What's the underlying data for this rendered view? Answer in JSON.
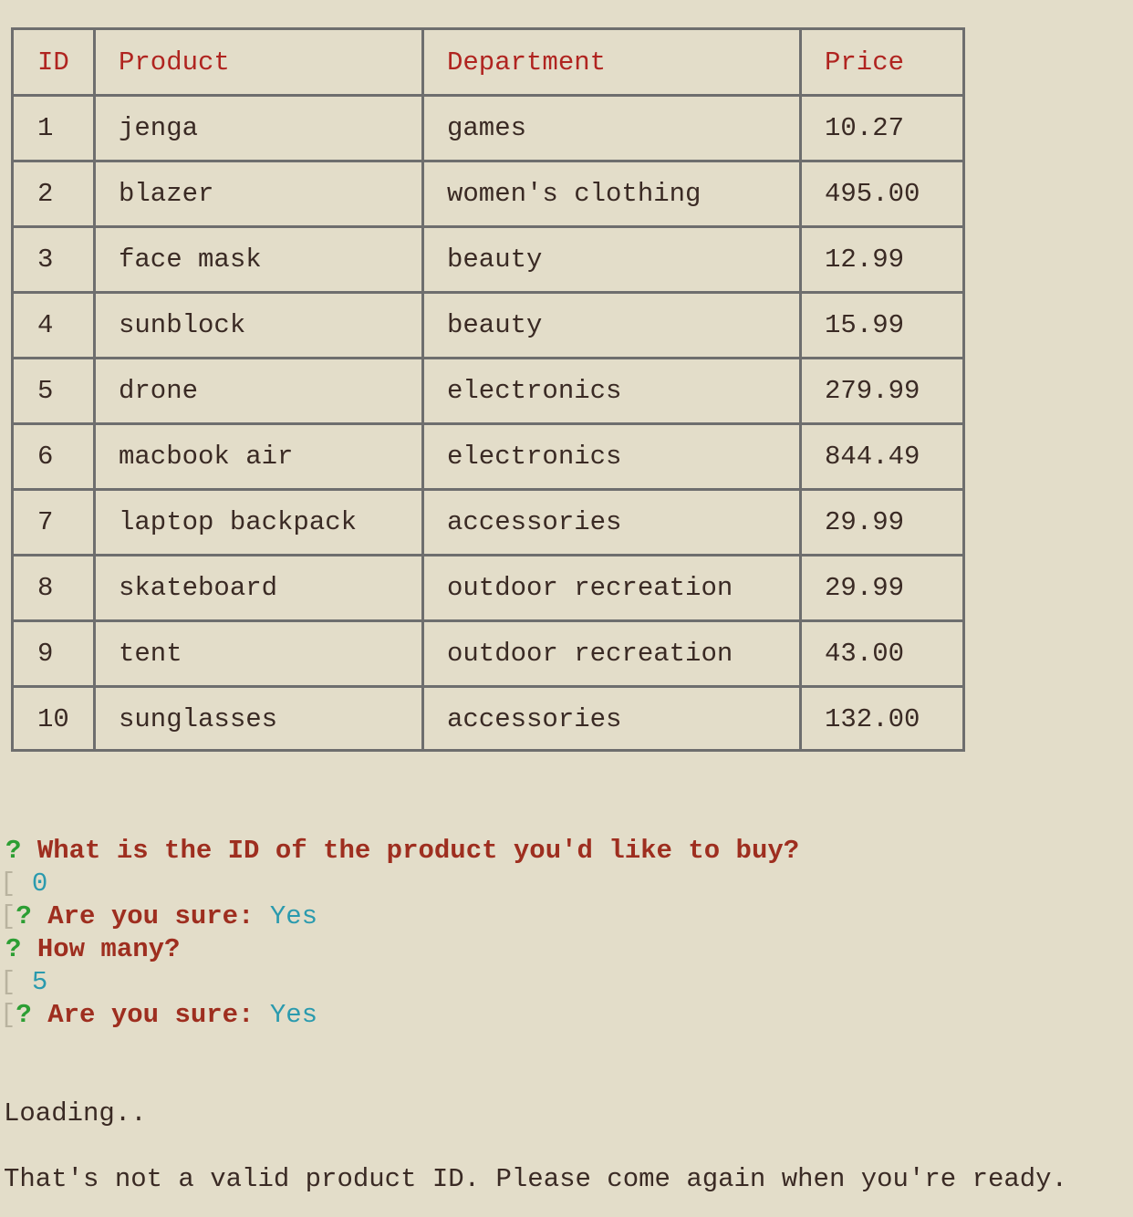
{
  "table": {
    "headers": {
      "id": "ID",
      "product": "Product",
      "department": "Department",
      "price": "Price"
    },
    "rows": [
      {
        "id": "1",
        "product": "jenga",
        "department": "games",
        "price": "10.27"
      },
      {
        "id": "2",
        "product": "blazer",
        "department": "women's clothing",
        "price": "495.00"
      },
      {
        "id": "3",
        "product": "face mask",
        "department": "beauty",
        "price": "12.99"
      },
      {
        "id": "4",
        "product": "sunblock",
        "department": "beauty",
        "price": "15.99"
      },
      {
        "id": "5",
        "product": "drone",
        "department": "electronics",
        "price": "279.99"
      },
      {
        "id": "6",
        "product": "macbook air",
        "department": "electronics",
        "price": "844.49"
      },
      {
        "id": "7",
        "product": "laptop backpack",
        "department": "accessories",
        "price": "29.99"
      },
      {
        "id": "8",
        "product": "skateboard",
        "department": "outdoor recreation",
        "price": "29.99"
      },
      {
        "id": "9",
        "product": "tent",
        "department": "outdoor recreation",
        "price": "43.00"
      },
      {
        "id": "10",
        "product": "sunglasses",
        "department": "accessories",
        "price": "132.00"
      }
    ]
  },
  "prompts": {
    "q_mark": "?",
    "id_question": "What is the ID of the product you'd like to buy?",
    "id_answer": "0",
    "confirm_label": "Are you sure:",
    "confirm_answer_1": "Yes",
    "qty_question": "How many?",
    "qty_answer": "5",
    "confirm_answer_2": "Yes"
  },
  "output": {
    "loading": "Loading..",
    "message": "That's not a valid product ID. Please come again when you're ready."
  },
  "colors": {
    "background": "#e3ddc9",
    "header_text": "#b02420",
    "question_mark": "#2c9e33",
    "question_text": "#9e2e1f",
    "answer": "#2a9aae",
    "table_border": "#6e6e6e"
  }
}
